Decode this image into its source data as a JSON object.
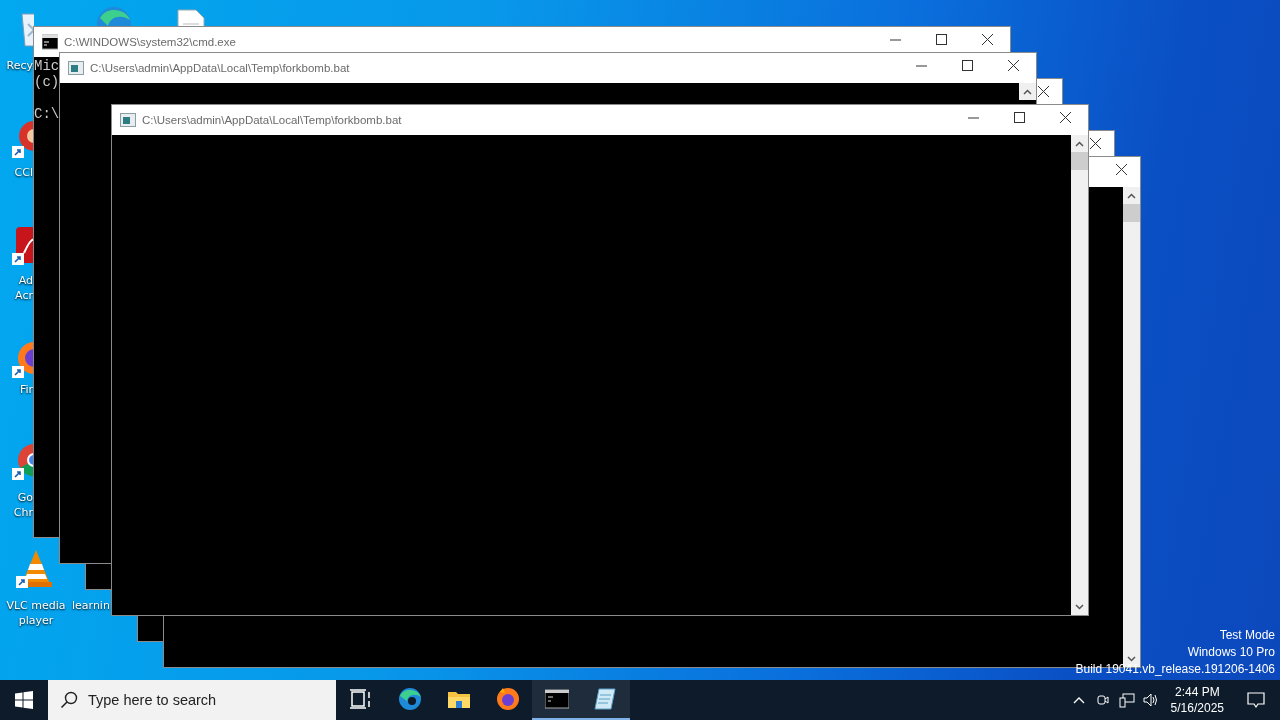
{
  "desktop": {
    "icons": [
      {
        "kind": "recycle",
        "lines": [
          "Recy"
        ]
      },
      {
        "kind": "cleaner",
        "lines": [
          "CCl"
        ]
      },
      {
        "kind": "acrobat",
        "lines": [
          "Ad",
          "Acr"
        ]
      },
      {
        "kind": "firefox",
        "lines": [
          "Fir"
        ]
      },
      {
        "kind": "chrome",
        "lines": [
          "Go",
          "Chr"
        ]
      },
      {
        "kind": "vlc",
        "lines": [
          "VLC media",
          "player"
        ]
      },
      {
        "lines": [
          "learnin"
        ]
      },
      {
        "kind": "edge"
      },
      {
        "kind": "file"
      }
    ],
    "watermark": [
      "Test Mode",
      "Windows 10 Pro",
      "Build 19041.vb_release.191206-1406"
    ]
  },
  "windows": [
    {
      "kind": "console",
      "title": "C:\\WINDOWS\\system32\\cmd.exe",
      "controls": [
        {
          "kind": "minimize"
        },
        {
          "kind": "maximize"
        },
        {
          "kind": "close"
        }
      ],
      "console_lines": [
        "Mic",
        "(c)"
      ],
      "prompt": "C:\\",
      "scrollbar": false
    },
    {
      "kind": "batch",
      "controls": [
        {
          "kind": "close"
        }
      ],
      "scrollbar": false
    },
    {
      "kind": "batch",
      "title": "C:\\Users\\admin\\AppData\\Local\\Temp\\forkbomb.bat",
      "controls": [
        {
          "kind": "minimize"
        },
        {
          "kind": "maximize"
        },
        {
          "kind": "close"
        }
      ],
      "scrollbar": true
    },
    {
      "kind": "batch",
      "controls": [
        {
          "kind": "close"
        }
      ],
      "scrollbar": false
    },
    {
      "kind": "batch",
      "controls": [
        {
          "kind": "close"
        }
      ],
      "scrollbar": true
    },
    {
      "kind": "batch",
      "title": "C:\\Users\\admin\\AppData\\Local\\Temp\\forkbomb.bat",
      "controls": [
        {
          "kind": "minimize"
        },
        {
          "kind": "maximize"
        },
        {
          "kind": "close"
        }
      ],
      "scrollbar": true
    }
  ],
  "taskbar": {
    "search": {
      "placeholder": "Type here to search"
    },
    "apps": [
      {
        "kind": "taskview",
        "running": false
      },
      {
        "kind": "edge",
        "running": false
      },
      {
        "kind": "explorer",
        "running": false
      },
      {
        "kind": "firefox",
        "running": false
      },
      {
        "kind": "terminal",
        "running": true
      },
      {
        "kind": "notepad",
        "running": true
      }
    ],
    "tray": {
      "time": "2:44 PM",
      "date": "5/16/2025"
    }
  }
}
